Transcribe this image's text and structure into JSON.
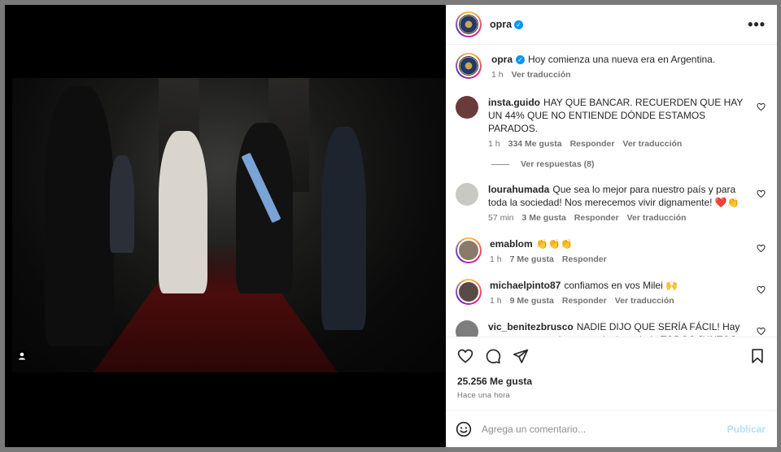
{
  "post": {
    "author": "opra",
    "caption_author": "opra",
    "caption": "Hoy comienza una nueva era en Argentina.",
    "caption_time": "1 h",
    "caption_translate": "Ver traducción"
  },
  "comments": [
    {
      "user": "insta.guido",
      "text": "HAY QUE BANCAR. RECUERDEN QUE HAY UN 44% QUE NO ENTIENDE DÓNDE ESTAMOS PARADOS.",
      "time": "1 h",
      "likes": "334 Me gusta",
      "reply": "Responder",
      "translate": "Ver traducción",
      "avatar_color": "#6b3a3a"
    },
    {
      "user": "lourahumada",
      "text": "Que sea lo mejor para nuestro país y para toda la sociedad! Nos merecemos vivir dignamente! ❤️👏",
      "time": "57 min",
      "likes": "3 Me gusta",
      "reply": "Responder",
      "translate": "Ver traducción",
      "avatar_color": "#c9c9c4"
    },
    {
      "user": "emablom",
      "text": "👏👏👏",
      "time": "1 h",
      "likes": "7 Me gusta",
      "reply": "Responder",
      "translate": "",
      "avatar_color": "#8a7a6a"
    },
    {
      "user": "michaelpinto87",
      "text": "confiamos en vos Milei 🙌",
      "time": "1 h",
      "likes": "9 Me gusta",
      "reply": "Responder",
      "translate": "Ver traducción",
      "avatar_color": "#5a4a44"
    },
    {
      "user": "vic_benitezbrusco",
      "text": "NADIE DIJO QUE SERÍA FÁCIL! Hay que aguantar y tirar para el mismo lado TODOS JUNTOS. HAY QUE",
      "time": "",
      "likes": "",
      "reply": "",
      "translate": "",
      "avatar_color": "#7d7d7d"
    }
  ],
  "view_replies": "Ver respuestas (8)",
  "likes_total": "25.256 Me gusta",
  "posted": "Hace una hora",
  "comment_box": {
    "placeholder": "Agrega un comentario...",
    "publish": "Publicar"
  },
  "icons": [
    "more-icon",
    "verified-icon",
    "heart-icon",
    "comment-icon",
    "share-icon",
    "bookmark-icon",
    "emoji-icon",
    "user-tag-icon"
  ],
  "colors": {
    "accent": "#0095f6",
    "text": "#262626",
    "muted": "#737373",
    "publish_disabled": "#b2dffc"
  }
}
